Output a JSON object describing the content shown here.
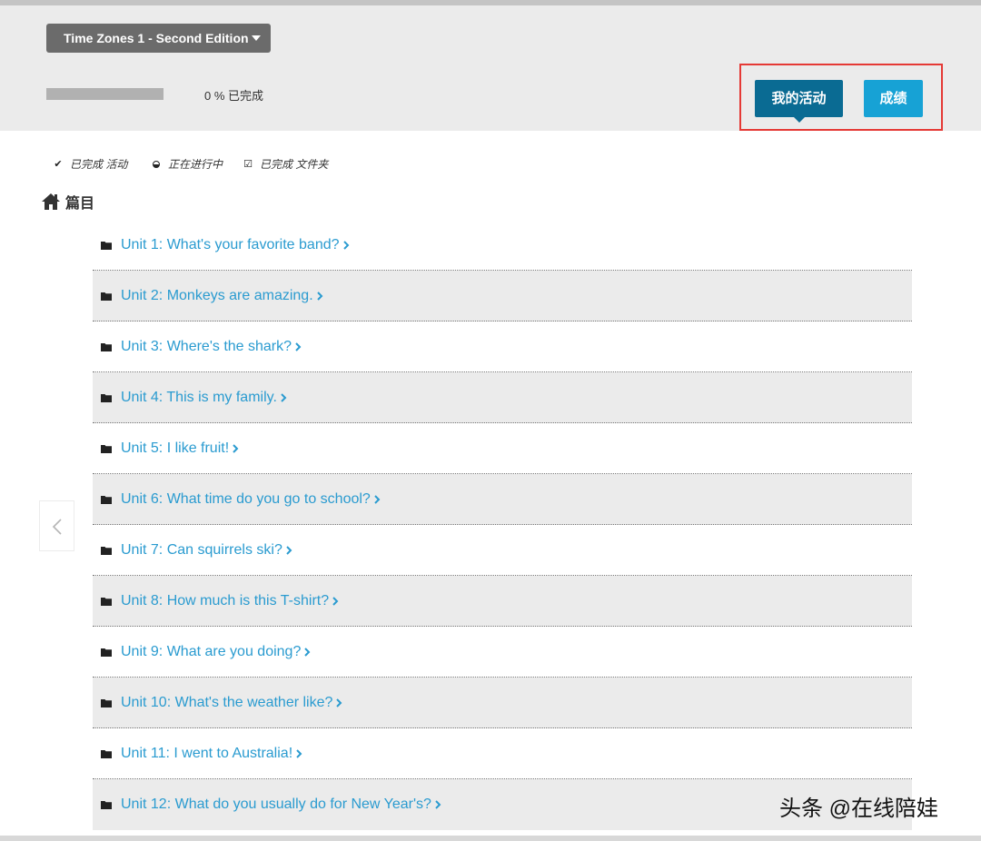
{
  "header": {
    "course_title": "Time Zones 1 - Second Edition",
    "progress_percent": 0,
    "progress_text": "0 %  已完成",
    "my_activities_label": "我的活动",
    "grades_label": "成绩",
    "highlight_color": "#e53935"
  },
  "legend": {
    "completed_activity": "已完成 活动",
    "in_progress": "正在进行中",
    "completed_folder": "已完成 文件夹"
  },
  "toc": {
    "title": "篇目",
    "units": [
      "Unit 1: What's your favorite band?",
      "Unit 2: Monkeys are amazing.",
      "Unit 3: Where's the shark?",
      "Unit 4: This is my family.",
      "Unit 5: I like fruit!",
      "Unit 6: What time do you go to school?",
      "Unit 7: Can squirrels ski?",
      "Unit 8: How much is this T-shirt?",
      "Unit 9: What are you doing?",
      "Unit 10: What's the weather like?",
      "Unit 11: I went to Australia!",
      "Unit 12: What do you usually do for New Year's?"
    ]
  },
  "watermark": "头条 @在线陪娃",
  "colors": {
    "link": "#2a9bd0",
    "primary_button": "#0a6b93",
    "secondary_button": "#17a2d5",
    "header_bg": "#ebebeb"
  }
}
